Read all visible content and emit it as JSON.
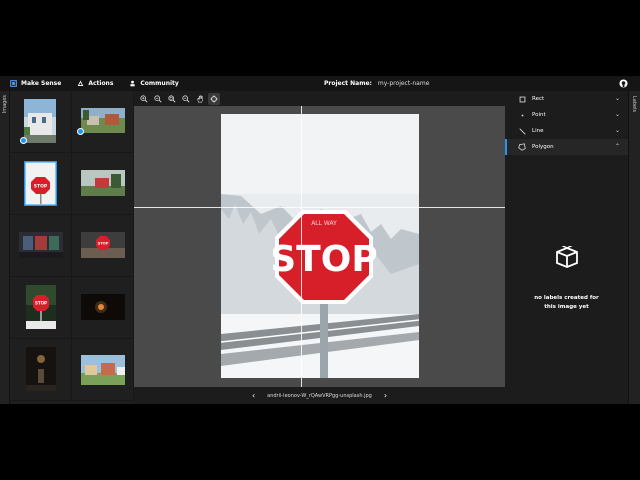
{
  "topbar": {
    "app_name": "Make Sense",
    "menu": [
      {
        "label": "Actions",
        "icon": "actions-icon"
      },
      {
        "label": "Community",
        "icon": "community-icon"
      }
    ],
    "project_label": "Project Name:",
    "project_value": "my-project-name",
    "github_icon": "github-icon"
  },
  "left_tab": {
    "label": "Images"
  },
  "right_tab": {
    "label": "Labels"
  },
  "thumbnails": [
    {
      "name": "thumb-street-building",
      "checked": true
    },
    {
      "name": "thumb-houses-yard",
      "checked": true
    },
    {
      "name": "thumb-stop-sign-snow",
      "checked": false,
      "selected": true
    },
    {
      "name": "thumb-red-barn",
      "checked": false
    },
    {
      "name": "thumb-shop-front",
      "checked": false
    },
    {
      "name": "thumb-stop-sign-sky",
      "checked": false
    },
    {
      "name": "thumb-stop-sign-forest",
      "checked": false
    },
    {
      "name": "thumb-dark-lamp",
      "checked": false
    },
    {
      "name": "thumb-night-figure",
      "checked": false
    },
    {
      "name": "thumb-street-houses",
      "checked": false
    }
  ],
  "toolbar": {
    "tools": [
      "zoom-in-icon",
      "zoom-out-icon",
      "zoom-fit-icon",
      "zoom-max-icon",
      "hand-icon",
      "crosshair-icon"
    ]
  },
  "image": {
    "sign_text": "STOP",
    "sign_top_text": "ALL WAY"
  },
  "navigation": {
    "filename": "andrii-leonov-W_rQAwVRPgg-unsplash.jpg"
  },
  "label_types": [
    {
      "label": "Rect",
      "icon": "rect-icon",
      "active": false
    },
    {
      "label": "Point",
      "icon": "point-icon",
      "active": false
    },
    {
      "label": "Line",
      "icon": "line-icon",
      "active": false
    },
    {
      "label": "Polygon",
      "icon": "polygon-icon",
      "active": true
    }
  ],
  "empty_state": {
    "line1": "no labels created for",
    "line2": "this image yet"
  },
  "colors": {
    "accent": "#2196f3",
    "stop_red": "#d71f2a"
  }
}
